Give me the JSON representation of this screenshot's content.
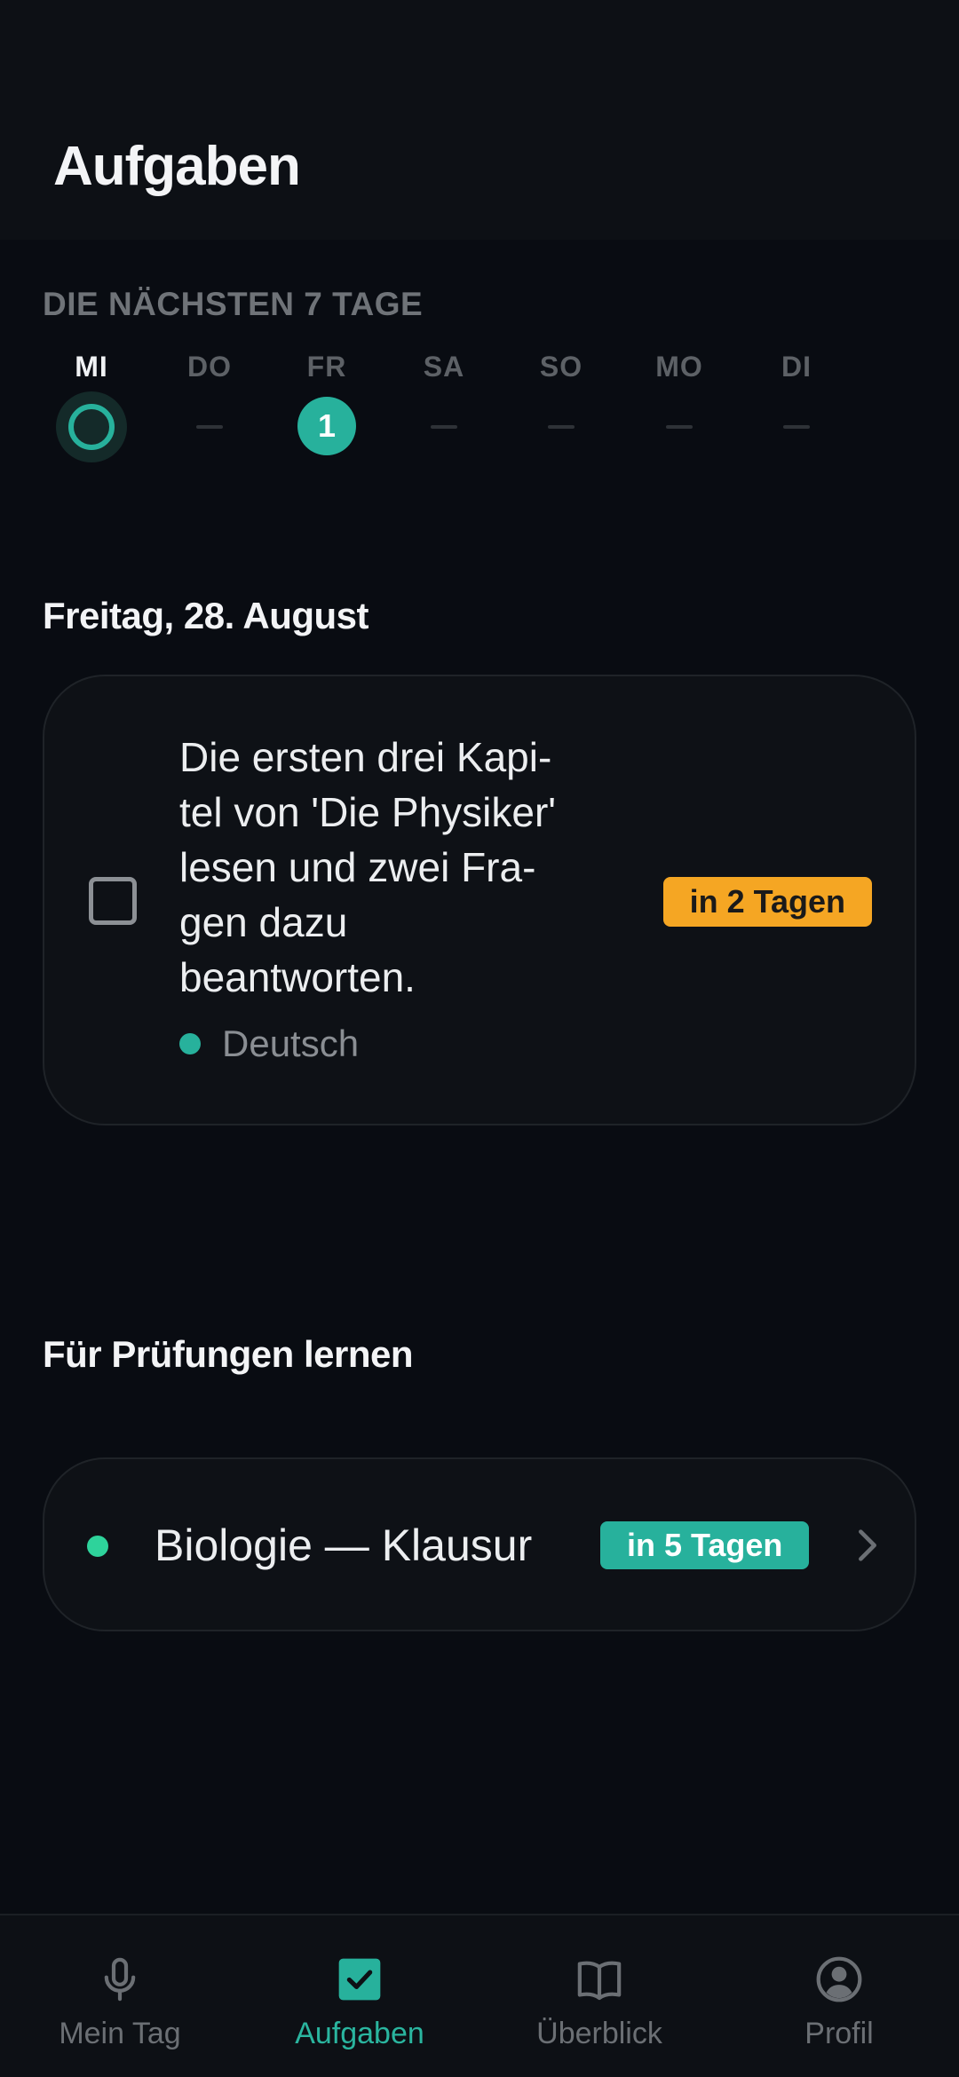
{
  "header": {
    "title": "Aufgaben"
  },
  "week": {
    "label": "DIE NÄCHSTEN 7 TAGE",
    "days": [
      {
        "name": "MI",
        "count": null,
        "today": true
      },
      {
        "name": "DO",
        "count": null
      },
      {
        "name": "FR",
        "count": "1"
      },
      {
        "name": "SA",
        "count": null
      },
      {
        "name": "SO",
        "count": null
      },
      {
        "name": "MO",
        "count": null
      },
      {
        "name": "DI",
        "count": null
      }
    ]
  },
  "tasks": {
    "date_heading": "Freitag, 28. August",
    "items": [
      {
        "text": "Die ersten drei Kapi-tel von 'Die Physiker' lesen und zwei Fra-gen dazu beantworten.",
        "subject": "Deutsch",
        "subject_color": "#27b19c",
        "due": "in 2 Tagen",
        "due_color": "#f5a623",
        "checked": false
      }
    ]
  },
  "exams": {
    "heading": "Für Prüfungen lernen",
    "items": [
      {
        "title": "Biologie — Klausur",
        "due": "in 5 Tagen",
        "dot_color": "#2ed39b",
        "due_color": "#27b19c"
      }
    ]
  },
  "nav": {
    "items": [
      {
        "label": "Mein Tag",
        "icon": "microphone-icon",
        "active": false
      },
      {
        "label": "Aufgaben",
        "icon": "checkbox-icon",
        "active": true
      },
      {
        "label": "Überblick",
        "icon": "book-icon",
        "active": false
      },
      {
        "label": "Profil",
        "icon": "profile-icon",
        "active": false
      }
    ]
  }
}
